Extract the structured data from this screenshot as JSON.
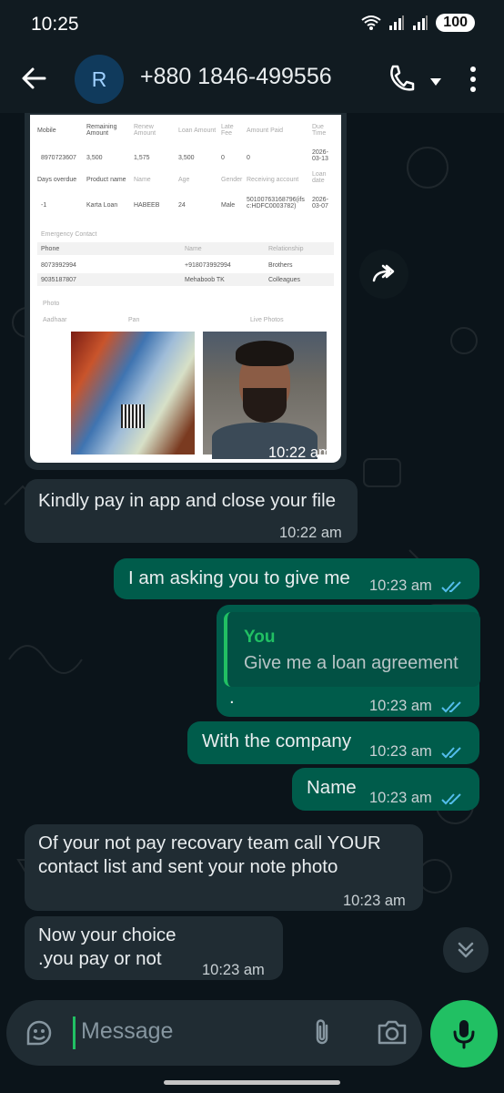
{
  "status": {
    "time": "10:25",
    "battery": "100"
  },
  "header": {
    "avatar_letter": "R",
    "contact": "+880 1846-499556"
  },
  "doc": {
    "r1h": [
      "Mobile",
      "Remaining Amount",
      "Renew Amount",
      "Loan Amount",
      "Late Fee",
      "Amount Paid",
      "Due Time"
    ],
    "r1v": [
      "8970723607",
      "3,500",
      "1,575",
      "3,500",
      "0",
      "0",
      "2026-03-13"
    ],
    "r2h": [
      "Days overdue",
      "Product name",
      "Name",
      "Age",
      "Gender",
      "Receiving account",
      "Loan date"
    ],
    "r2v": [
      "-1",
      "Karta Loan",
      "HABEEB",
      "24",
      "Male",
      "50100763168796(ifsc:HDFC0003782)",
      "2026-03-07"
    ],
    "emergency_title": "Emergency Contact",
    "ec_head": [
      "Phone",
      "Name",
      "Relationship"
    ],
    "ec_rows": [
      [
        "8073992994",
        "+918073992994",
        "Brothers"
      ],
      [
        "9035187807",
        "Mehaboob TK",
        "Colleagues"
      ]
    ],
    "photo_title": "Photo",
    "photo_heads": [
      "Aadhaar",
      "Pan",
      "Live Photos"
    ]
  },
  "messages": {
    "m0_time": "10:22 am",
    "m1_text": "Kindly pay in app and close your file",
    "m1_time": "10:22 am",
    "m2_text": "I am asking you to give me",
    "m2_time": "10:23 am",
    "m3_quote_author": "You",
    "m3_quote_text": "Give me a loan agreement",
    "m3_text": ".",
    "m3_time": "10:23 am",
    "m4_text": "With the company",
    "m4_time": "10:23 am",
    "m5_text": "Name",
    "m5_time": "10:23 am",
    "m6_text_l1": "Of your not pay recovary team call YOUR",
    "m6_text_l2": "contact list and sent your note photo",
    "m6_time": "10:23 am",
    "m7_text_l1": "Now your choice",
    "m7_text_l2": ".you pay or not",
    "m7_time": "10:23 am"
  },
  "composer": {
    "placeholder": "Message"
  },
  "colors": {
    "accent": "#21c063",
    "outgoing": "#005c4b",
    "incoming": "#202c33",
    "read_ticks": "#53bdeb"
  }
}
